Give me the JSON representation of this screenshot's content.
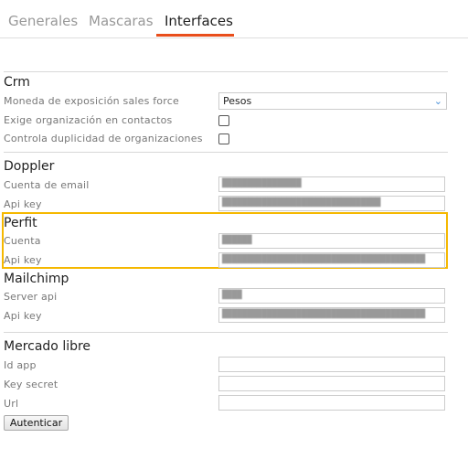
{
  "tabs": [
    {
      "label": "Generales",
      "active": false
    },
    {
      "label": "Mascaras",
      "active": false
    },
    {
      "label": "Interfaces",
      "active": true
    }
  ],
  "accent_color": "#e94e1b",
  "highlight_color": "#f5b800",
  "crm": {
    "title": "Crm",
    "currency_label": "Moneda de exposición sales force",
    "currency_value": "Pesos",
    "require_org_label": "Exige organización en contactos",
    "require_org_checked": false,
    "check_dup_label": "Controla duplicidad de organizaciones",
    "check_dup_checked": false
  },
  "doppler": {
    "title": "Doppler",
    "email_label": "Cuenta de email",
    "email_value": "████████████████",
    "apikey_label": "Api key",
    "apikey_value": "████████████████████████████████"
  },
  "perfit": {
    "title": "Perfit",
    "account_label": "Cuenta",
    "account_value": "██████",
    "apikey_label": "Api key",
    "apikey_value": "█████████████████████████████████████████"
  },
  "mailchimp": {
    "title": "Mailchimp",
    "server_label": "Server api",
    "server_value": "████",
    "apikey_label": "Api key",
    "apikey_value": "█████████████████████████████████████████"
  },
  "mercado_libre": {
    "title": "Mercado libre",
    "id_label": "Id app",
    "id_value": "",
    "secret_label": "Key secret",
    "secret_value": "",
    "url_label": "Url",
    "url_value": "",
    "auth_button": "Autenticar"
  }
}
